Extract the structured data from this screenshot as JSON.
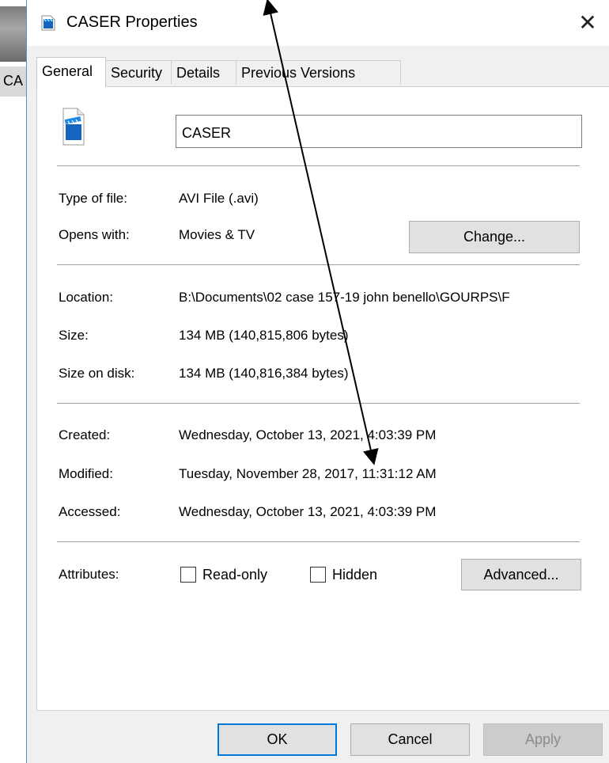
{
  "background": {
    "side_label": "CA",
    "top_text": ","
  },
  "window": {
    "title": "CASER Properties",
    "close_glyph": "✕"
  },
  "tabs": [
    {
      "label": "General",
      "active": true
    },
    {
      "label": "Security",
      "active": false
    },
    {
      "label": "Details",
      "active": false
    },
    {
      "label": "Previous Versions",
      "active": false
    }
  ],
  "file": {
    "icon": "video-file-icon",
    "name": "CASER"
  },
  "type_section": {
    "type_label": "Type of file:",
    "type_value": "AVI File (.avi)",
    "opens_label": "Opens with:",
    "opens_value": "Movies & TV",
    "change_button": "Change..."
  },
  "location_section": {
    "location_label": "Location:",
    "location_value": "B:\\Documents\\02 case 157-19 john benello\\GOURPS\\F",
    "size_label": "Size:",
    "size_value": "134 MB (140,815,806 bytes)",
    "size_on_disk_label": "Size on disk:",
    "size_on_disk_value": "134 MB (140,816,384 bytes)"
  },
  "dates_section": {
    "created_label": "Created:",
    "created_value": "Wednesday, October 13, 2021, 4:03:39 PM",
    "modified_label": "Modified:",
    "modified_value": "Tuesday, November 28, 2017, 11:31:12 AM",
    "accessed_label": "Accessed:",
    "accessed_value": "Wednesday, October 13, 2021, 4:03:39 PM"
  },
  "attributes": {
    "label": "Attributes:",
    "read_only_label": "Read-only",
    "read_only_checked": false,
    "hidden_label": "Hidden",
    "hidden_checked": false,
    "advanced_button": "Advanced..."
  },
  "footer": {
    "ok": "OK",
    "cancel": "Cancel",
    "apply": "Apply"
  },
  "colors": {
    "accent": "#0078d7",
    "dialog_bg": "#f0f0f0",
    "panel_bg": "#ffffff"
  }
}
